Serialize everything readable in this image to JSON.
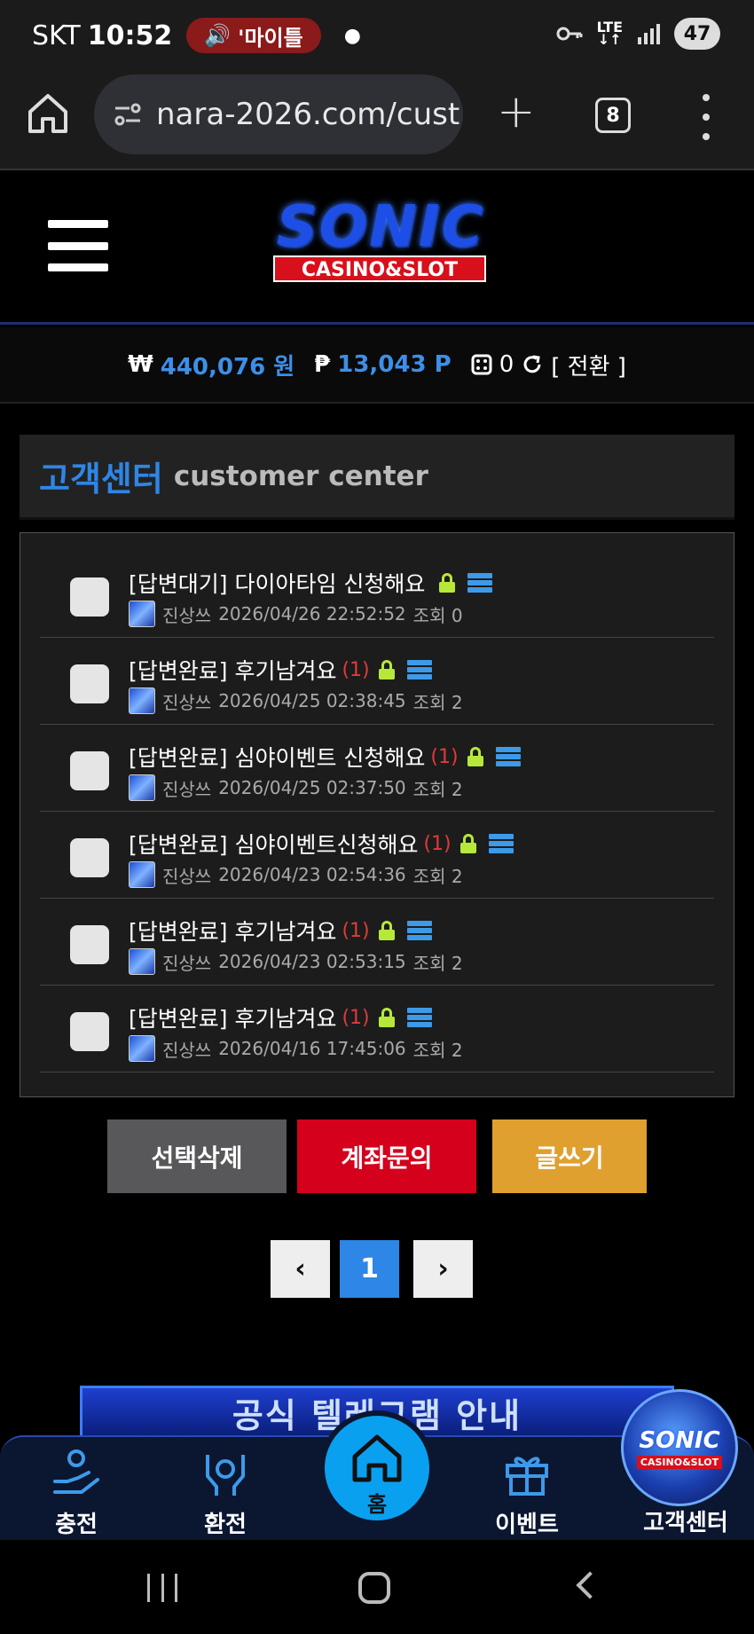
{
  "status_bar": {
    "carrier": "SKT",
    "time": "10:52",
    "media_label": "'마이틀",
    "network": "LTE",
    "battery": "47"
  },
  "browser": {
    "url": "nara-2026.com/cust",
    "tab_count": "8"
  },
  "site": {
    "logo_word": "SONIC",
    "logo_sub": "CASINO&SLOT"
  },
  "balance": {
    "won_symbol": "₩",
    "won_value": "440,076 원",
    "point_symbol": "₱",
    "point_value": "13,043 P",
    "chip_value": "0",
    "convert_label": "[ 전환 ]"
  },
  "page_title": {
    "korean": "고객센터",
    "english": "customer center"
  },
  "posts": [
    {
      "title": "[답변대기] 다이아타임 신청해요",
      "count": "",
      "author": "진상쓰",
      "datetime": "2026/04/26 22:52:52",
      "views": "조회 0"
    },
    {
      "title": "[답변완료] 후기남겨요",
      "count": "(1)",
      "author": "진상쓰",
      "datetime": "2026/04/25 02:38:45",
      "views": "조회 2"
    },
    {
      "title": "[답변완료] 심야이벤트 신청해요",
      "count": "(1)",
      "author": "진상쓰",
      "datetime": "2026/04/25 02:37:50",
      "views": "조회 2"
    },
    {
      "title": "[답변완료] 심야이벤트신청해요",
      "count": "(1)",
      "author": "진상쓰",
      "datetime": "2026/04/23 02:54:36",
      "views": "조회 2"
    },
    {
      "title": "[답변완료] 후기남겨요",
      "count": "(1)",
      "author": "진상쓰",
      "datetime": "2026/04/23 02:53:15",
      "views": "조회 2"
    },
    {
      "title": "[답변완료] 후기남겨요",
      "count": "(1)",
      "author": "진상쓰",
      "datetime": "2026/04/16 17:45:06",
      "views": "조회 2"
    }
  ],
  "actions": {
    "delete_selected": "선택삭제",
    "account_inquiry": "계좌문의",
    "write": "글쓰기"
  },
  "pagination": {
    "prev": "‹",
    "current": "1",
    "next": "›"
  },
  "banner": {
    "text": "공식 텔레그램 안내"
  },
  "bottom_nav": {
    "charge": "충전",
    "exchange": "환전",
    "home": "홈",
    "event": "이벤트",
    "customer_center": "고객센터"
  },
  "colors": {
    "accent_blue": "#2e86e6",
    "danger_red": "#d4001c",
    "write_yellow": "#e0a030",
    "lock_green": "#b6e83a"
  }
}
